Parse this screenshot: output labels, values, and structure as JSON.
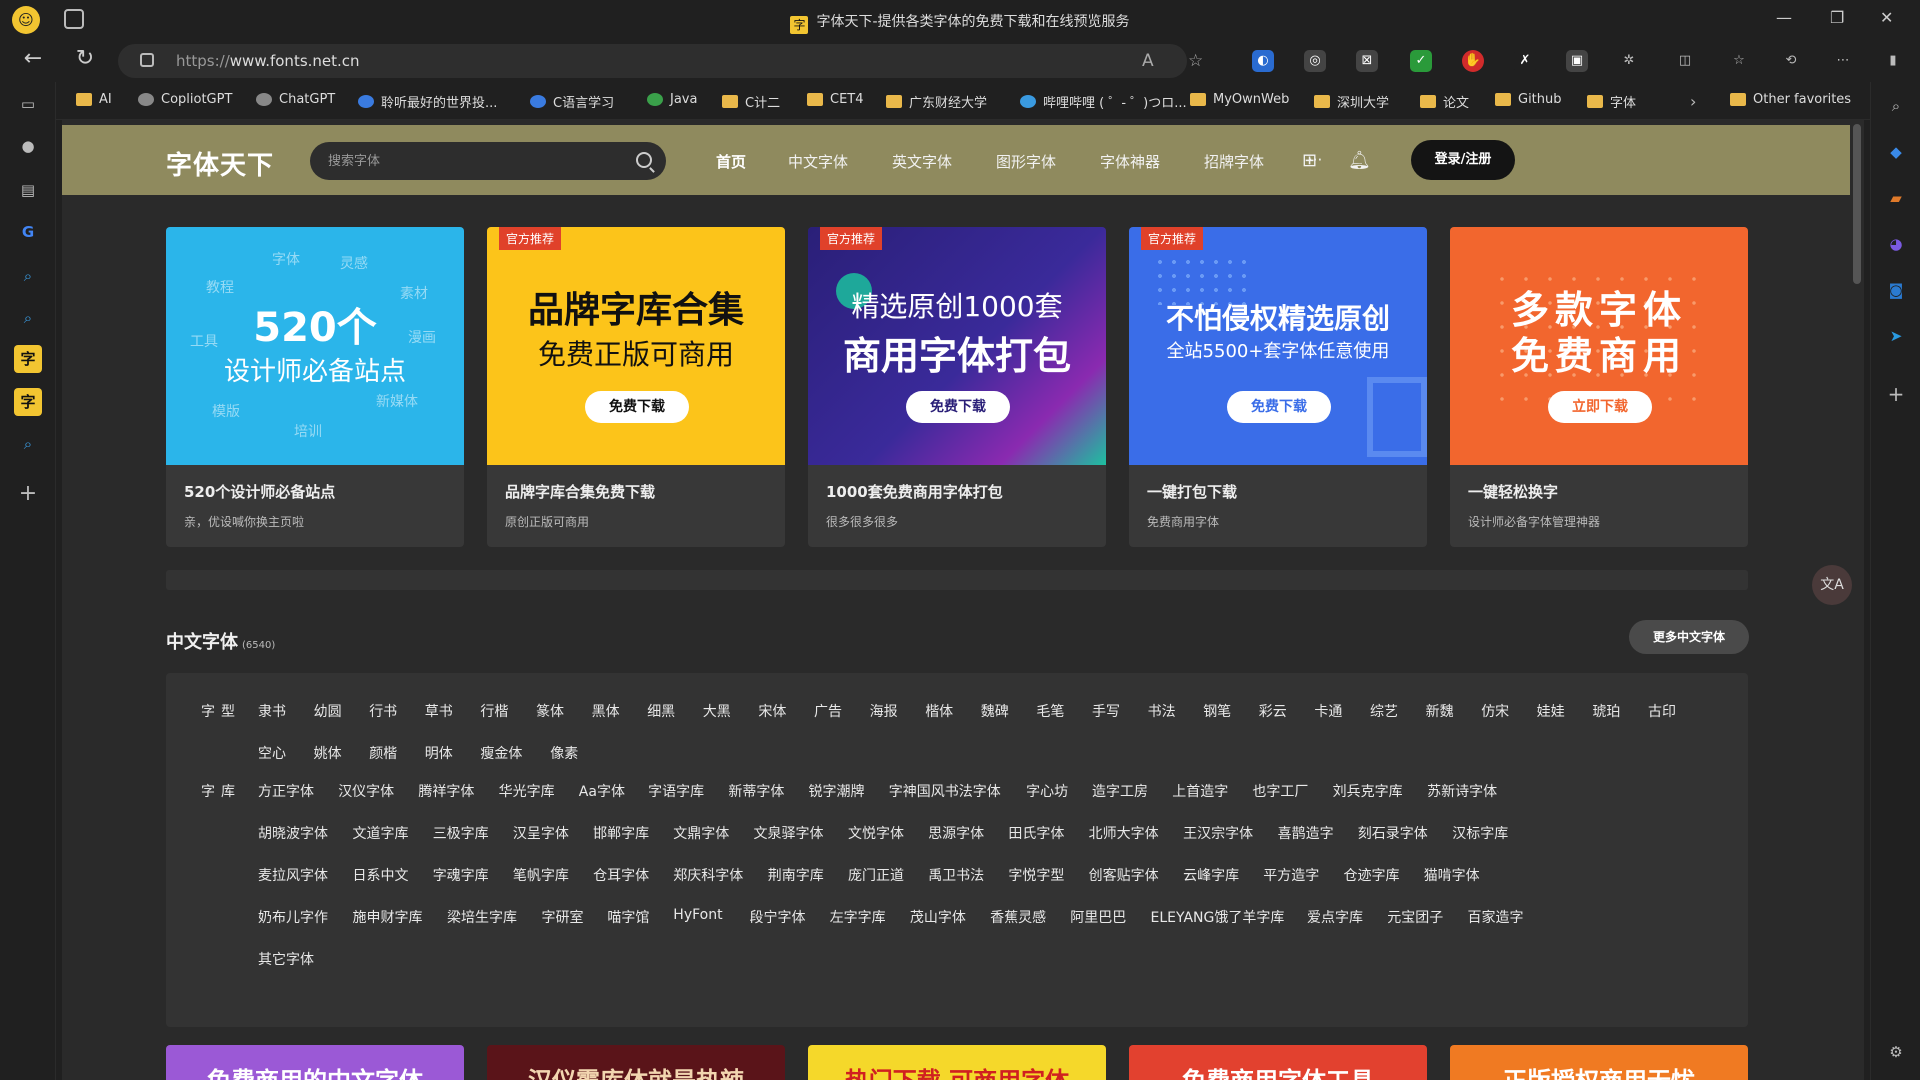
{
  "window": {
    "title": "字体天下-提供各类字体的免费下载和在线预览服务",
    "favicon_text": "字"
  },
  "address": {
    "url_scheme": "https://",
    "url_host": "www.fonts.net.cn"
  },
  "favorites": [
    {
      "label": "AI",
      "icon": "folder"
    },
    {
      "label": "CopliotGPT",
      "icon": "site"
    },
    {
      "label": "ChatGPT",
      "icon": "site"
    },
    {
      "label": "聆听最好的世界投...",
      "icon": "site"
    },
    {
      "label": "C语言学习",
      "icon": "site"
    },
    {
      "label": "Java",
      "icon": "site"
    },
    {
      "label": "C计二",
      "icon": "folder"
    },
    {
      "label": "CET4",
      "icon": "folder"
    },
    {
      "label": "广东财经大学",
      "icon": "folder"
    },
    {
      "label": "哔哩哔哩 ( ゜- ゜)つロ...",
      "icon": "site"
    },
    {
      "label": "MyOwnWeb",
      "icon": "folder"
    },
    {
      "label": "深圳大学",
      "icon": "folder"
    },
    {
      "label": "论文",
      "icon": "folder"
    },
    {
      "label": "Github",
      "icon": "folder"
    },
    {
      "label": "字体",
      "icon": "folder"
    }
  ],
  "other_favorites": "Other favorites",
  "site": {
    "logo": "字体天下",
    "search_placeholder": "搜索字体",
    "menu": [
      "首页",
      "中文字体",
      "英文字体",
      "图形字体",
      "字体神器",
      "招牌字体",
      "···"
    ],
    "login": "登录/注册"
  },
  "cards": [
    {
      "banner_bg": "#2bb5ea",
      "headline": "520个",
      "subline": "设计师必备站点",
      "words": [
        "字体",
        "灵感",
        "教程",
        "素材",
        "工具",
        "漫画",
        "模版",
        "新媒体",
        "培训"
      ],
      "title": "520个设计师必备站点",
      "sub": "亲，优设喊你换主页啦"
    },
    {
      "banner_bg": "#fcc41a",
      "badge": "官方推荐",
      "headline": "品牌字库合集",
      "subline": "免费正版可商用",
      "button": "免费下载",
      "title": "品牌字库合集免费下载",
      "sub": "原创正版可商用"
    },
    {
      "banner_bg": "#2a1f78",
      "badge": "官方推荐",
      "headline": "精选原创1000套",
      "subline": "商用字体打包",
      "button": "免费下载",
      "title": "1000套免费商用字体打包",
      "sub": "很多很多很多"
    },
    {
      "banner_bg": "#3a6de8",
      "badge": "官方推荐",
      "headline": "不怕侵权精选原创",
      "subline": "全站5500+套字体任意使用",
      "button": "免费下载",
      "title": "一键打包下载",
      "sub": "免费商用字体"
    },
    {
      "banner_bg": "#f2662e",
      "headline": "多款字体",
      "subline": "免费商用",
      "button": "立即下载",
      "title": "一键轻松换字",
      "sub": "设计师必备字体管理神器"
    }
  ],
  "section": {
    "title": "中文字体",
    "count": "(6540)",
    "more": "更多中文字体",
    "type_label": "字型",
    "types_row1": [
      "隶书",
      "幼圆",
      "行书",
      "草书",
      "行楷",
      "篆体",
      "黑体",
      "细黑",
      "大黑",
      "宋体",
      "广告",
      "海报",
      "楷体",
      "魏碑",
      "毛笔",
      "手写",
      "书法",
      "钢笔",
      "彩云",
      "卡通",
      "综艺",
      "新魏",
      "仿宋",
      "娃娃",
      "琥珀",
      "古印"
    ],
    "types_row2": [
      "空心",
      "姚体",
      "颜楷",
      "明体",
      "瘦金体",
      "像素"
    ],
    "lib_label": "字库",
    "libs_row1": [
      "方正字体",
      "汉仪字体",
      "腾祥字体",
      "华光字库",
      "Aa字体",
      "字语字库",
      "新蒂字体",
      "锐字潮牌",
      "字神国风书法字体",
      "字心坊",
      "造字工房",
      "上首造字",
      "也字工厂",
      "刘兵克字库",
      "苏新诗字体"
    ],
    "libs_row2": [
      "胡晓波字体",
      "文道字库",
      "三极字库",
      "汉呈字体",
      "邯郸字库",
      "文鼎字体",
      "文泉驿字体",
      "文悦字体",
      "思源字体",
      "田氏字体",
      "北师大字体",
      "王汉宗字体",
      "喜鹊造字",
      "刻石录字体",
      "汉标字库"
    ],
    "libs_row3": [
      "麦拉风字体",
      "日系中文",
      "字魂字库",
      "笔帆字库",
      "仓耳字体",
      "郑庆科字体",
      "荆南字库",
      "庞门正道",
      "禹卫书法",
      "字悦字型",
      "创客贴字体",
      "云峰字库",
      "平方造字",
      "仓迹字库",
      "猫啃字体"
    ],
    "libs_row4": [
      "奶布儿字作",
      "施申财字库",
      "梁培生字库",
      "字研室",
      "喵字馆",
      "HyFont",
      "段宁字体",
      "左字字库",
      "茂山字体",
      "香蕉灵感",
      "阿里巴巴",
      "ELEYANG饿了羊字库",
      "爱点字库",
      "元宝团子",
      "百家造字"
    ],
    "libs_row5": [
      "其它字体"
    ]
  },
  "bottom_cards": [
    {
      "text": "免费商用的中文字体",
      "bg": "#9b59d6",
      "color": "#fff"
    },
    {
      "text": "汉仪霸库体就是热辣",
      "bg": "#5a1419",
      "color": "#f2d6b0"
    },
    {
      "text": "热门下载 可商用字体",
      "bg": "#f5d82a",
      "color": "#d02020"
    },
    {
      "text": "免费商用字体工具",
      "bg": "#e2412f",
      "color": "#fff"
    },
    {
      "text": "正版授权商用无忧",
      "bg": "#f07a22",
      "color": "#fff"
    }
  ]
}
